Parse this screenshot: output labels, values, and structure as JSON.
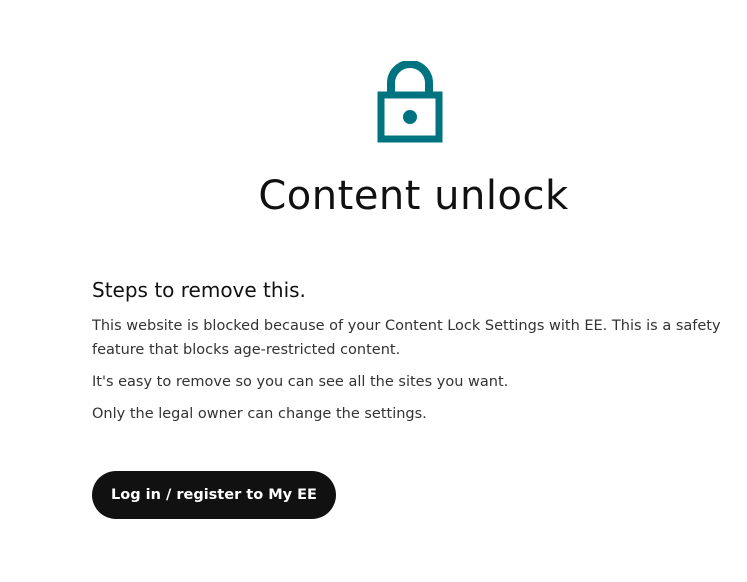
{
  "page": {
    "title": "Content unlock",
    "icon": "lock-icon",
    "accent_color": "#007380"
  },
  "content": {
    "heading": "Steps to remove this.",
    "paragraphs": [
      "This website is blocked because of your Content Lock Settings with EE. This is a safety feature that blocks age-restricted content.",
      "It's easy to remove so you can see all the sites you want.",
      "Only the legal owner can change the settings."
    ]
  },
  "actions": {
    "login_button_label": "Log in / register to My EE",
    "button_color": "#111111"
  }
}
